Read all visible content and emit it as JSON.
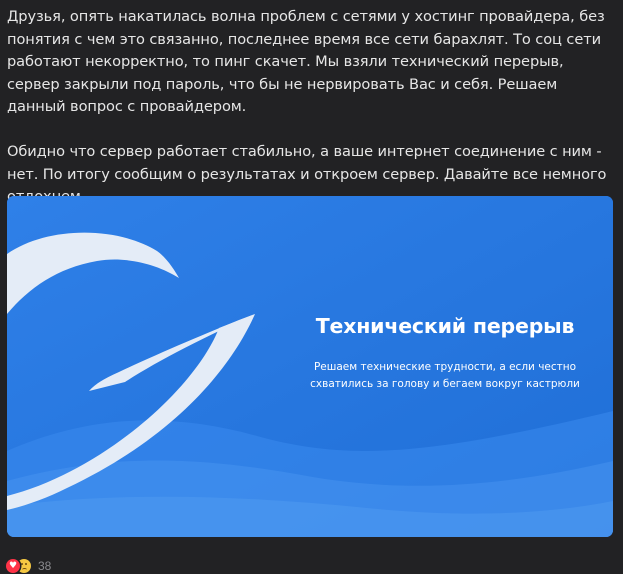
{
  "post": {
    "paragraph_1": "Друзья, опять накатилась волна проблем с сетями у хостинг провайдера, без понятия с чем это связанно, последнее время все сети барахлят. То соц сети работают некорректно, то пинг скачет. Мы взяли технический перерыв, сервер закрыли под пароль, что бы не нервировать Вас и себя. Решаем данный вопрос с провайдером.",
    "paragraph_2": "Обидно что сервер работает стабильно, а ваше интернет соединение с ним - нет. По итогу сообщим о результатах и откроем сервер. Давайте все немного отдохнем."
  },
  "banner": {
    "title": "Технический перерыв",
    "subtitle_line_1": "Решаем технические трудности, а если честно",
    "subtitle_line_2": "схватились за голову и бегаем вокруг кастрюли",
    "background_color": "#2a7ae0",
    "logo_color": "#e4ecf7"
  },
  "reactions": {
    "icons": [
      "heart-icon",
      "sad-face-icon"
    ],
    "heart_color": "#ff3347",
    "count": "38"
  }
}
